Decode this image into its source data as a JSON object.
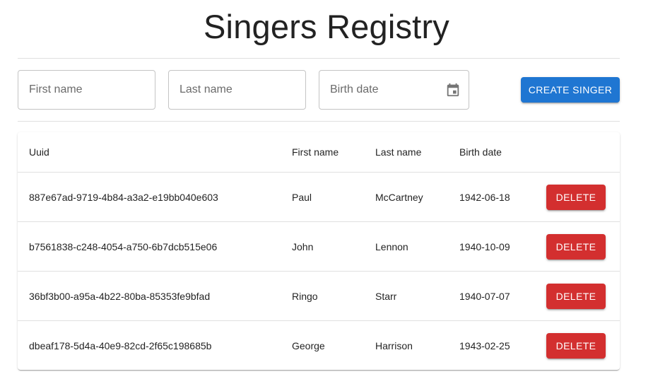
{
  "page": {
    "title": "Singers Registry"
  },
  "form": {
    "first_name": {
      "placeholder": "First name",
      "value": ""
    },
    "last_name": {
      "placeholder": "Last name",
      "value": ""
    },
    "birth_date": {
      "placeholder": "Birth date",
      "value": "",
      "icon": "calendar-icon"
    },
    "create_label": "Create singer"
  },
  "table": {
    "headers": {
      "uuid": "Uuid",
      "first_name": "First name",
      "last_name": "Last name",
      "birth_date": "Birth date"
    },
    "rows": [
      {
        "uuid": "887e67ad-9719-4b84-a3a2-e19bb040e603",
        "first_name": "Paul",
        "last_name": "McCartney",
        "birth_date": "1942-06-18",
        "action": "Delete"
      },
      {
        "uuid": "b7561838-c248-4054-a750-6b7dcb515e06",
        "first_name": "John",
        "last_name": "Lennon",
        "birth_date": "1940-10-09",
        "action": "Delete"
      },
      {
        "uuid": "36bf3b00-a95a-4b22-80ba-85353fe9bfad",
        "first_name": "Ringo",
        "last_name": "Starr",
        "birth_date": "1940-07-07",
        "action": "Delete"
      },
      {
        "uuid": "dbeaf178-5d4a-40e9-82cd-2f65c198685b",
        "first_name": "George",
        "last_name": "Harrison",
        "birth_date": "1943-02-25",
        "action": "Delete"
      }
    ]
  },
  "colors": {
    "primary": "#1f76d2",
    "danger": "#d32f2f",
    "divider": "#e0e0e0"
  }
}
